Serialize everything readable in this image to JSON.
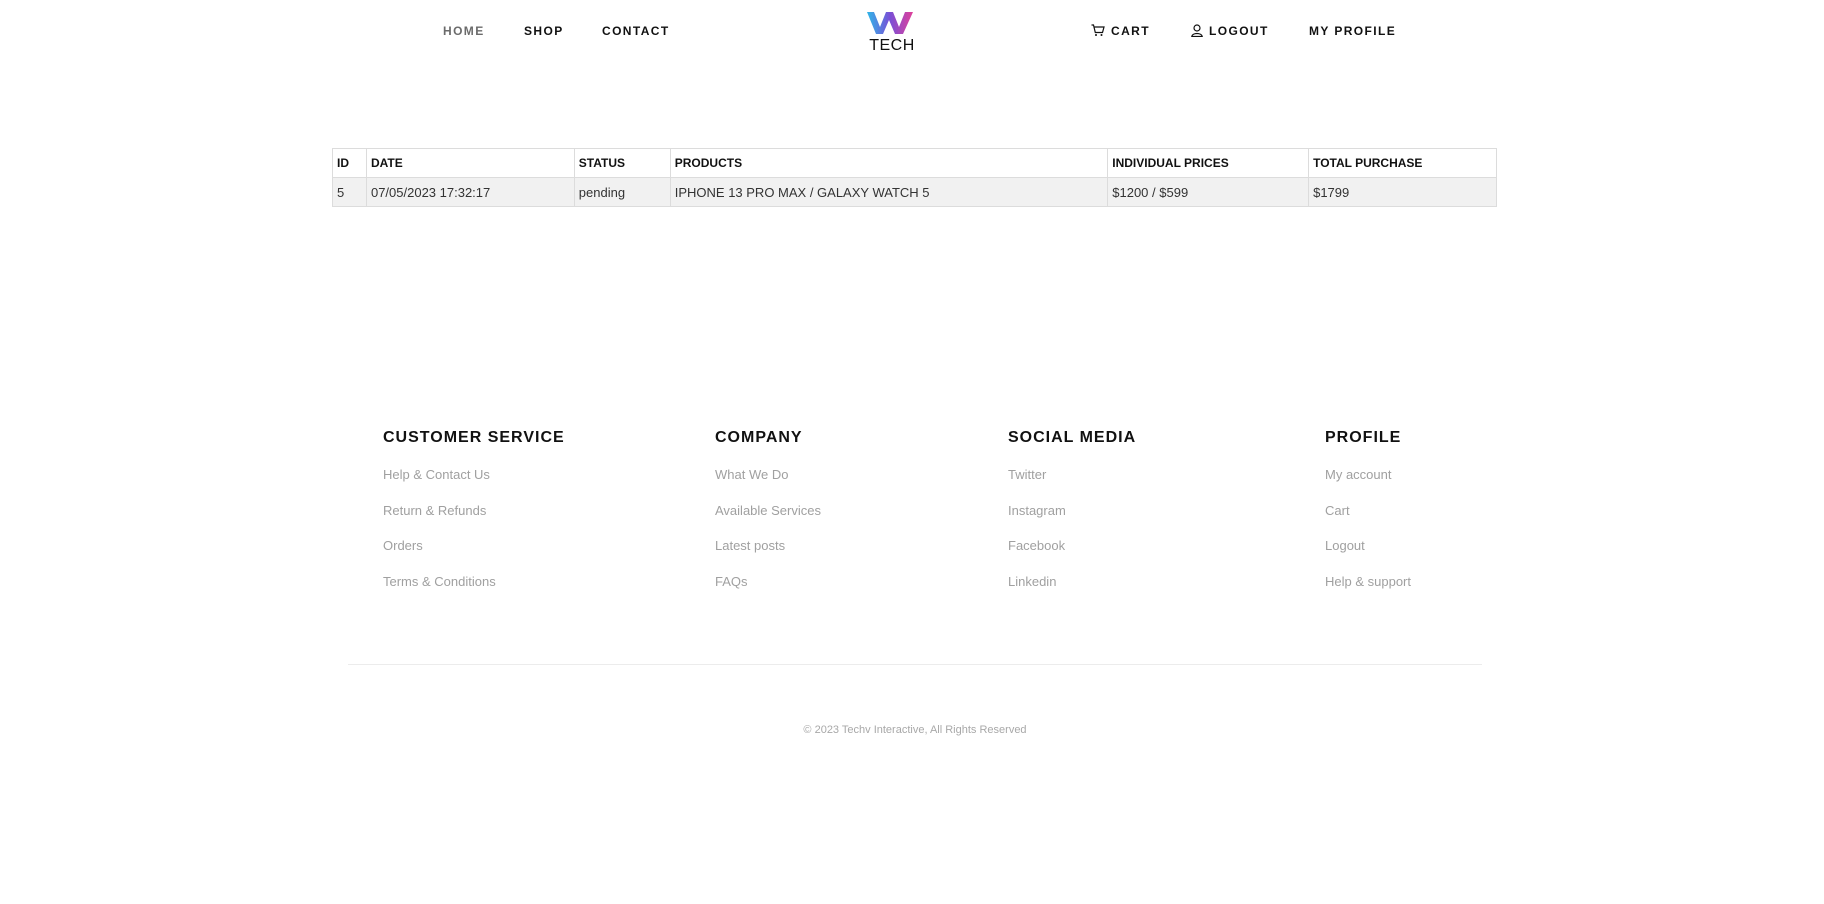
{
  "nav": {
    "home": "HOME",
    "shop": "SHOP",
    "contact": "CONTACT",
    "cart": "CART",
    "logout": "LOGOUT",
    "my_profile": "MY PROFILE",
    "logo_text": "TECH",
    "icons": {
      "cart": "cart-icon",
      "logout": "user-icon"
    }
  },
  "orders": {
    "headers": [
      "ID",
      "DATE",
      "STATUS",
      "PRODUCTS",
      "INDIVIDUAL PRICES",
      "TOTAL PURCHASE"
    ],
    "rows": [
      [
        "5",
        "07/05/2023 17:32:17",
        "pending",
        "IPHONE 13 PRO MAX / GALAXY WATCH 5",
        "$1200 / $599",
        "$1799"
      ]
    ]
  },
  "footer": {
    "customer_service": {
      "heading": "CUSTOMER SERVICE",
      "links": [
        "Help & Contact Us",
        "Return & Refunds",
        "Orders",
        "Terms & Conditions"
      ]
    },
    "company": {
      "heading": "COMPANY",
      "links": [
        "What We Do",
        "Available Services",
        "Latest posts",
        "FAQs"
      ]
    },
    "social_media": {
      "heading": "SOCIAL MEDIA",
      "links": [
        "Twitter",
        "Instagram",
        "Facebook",
        "Linkedin"
      ]
    },
    "profile": {
      "heading": "PROFILE",
      "links": [
        "My account",
        "Cart",
        "Logout",
        "Help & support"
      ]
    },
    "copyright": "© 2023 Techv Interactive, All Rights Reserved"
  },
  "colors": {
    "logo_gradient_start": "#2fb6e8",
    "logo_gradient_mid": "#7a4fd6",
    "logo_gradient_end": "#e0409a",
    "muted_text": "#a0a0a0"
  }
}
